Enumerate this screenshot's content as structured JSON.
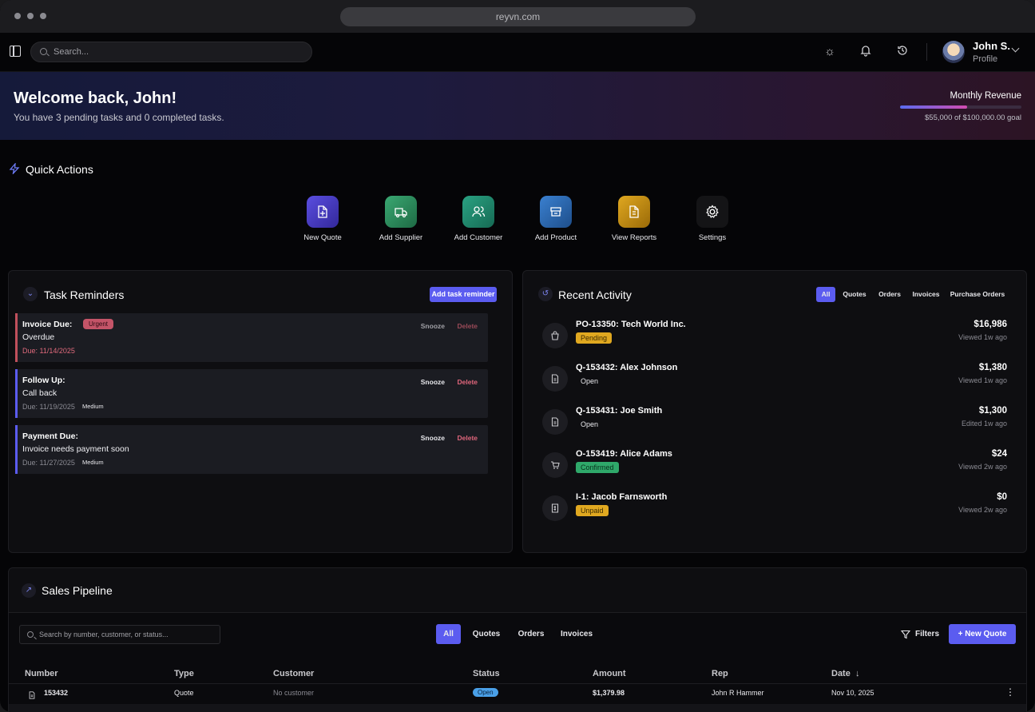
{
  "browser": {
    "url": "reyvn.com"
  },
  "topbar": {
    "search_placeholder": "Search...",
    "user_name": "John S.",
    "user_sub": "Profile"
  },
  "banner": {
    "welcome": "Welcome back, John!",
    "subtitle": "You have 3 pending tasks and 0 completed tasks.",
    "revenue_title": "Monthly Revenue",
    "revenue_text": "$55,000 of $100,000.00 goal",
    "revenue_progress": 0.55
  },
  "quick_actions": {
    "title": "Quick Actions",
    "items": [
      {
        "label": "New Quote",
        "icon": "file-plus-icon",
        "color": "#4a3ec8"
      },
      {
        "label": "Add Supplier",
        "icon": "truck-icon",
        "color": "#2a8a5a"
      },
      {
        "label": "Add Customer",
        "icon": "users-icon",
        "color": "#1e8a6a"
      },
      {
        "label": "Add Product",
        "icon": "box-icon",
        "color": "#2a6ab8"
      },
      {
        "label": "View Reports",
        "icon": "report-icon",
        "color": "#c08a10"
      },
      {
        "label": "Settings",
        "icon": "gear-icon",
        "color": "#141416"
      }
    ]
  },
  "tasks": {
    "title": "Task Reminders",
    "add_label": "Add task reminder",
    "snooze_label": "Snooze",
    "delete_label": "Delete",
    "items": [
      {
        "type": "Invoice Due:",
        "desc": "Overdue",
        "due": "Due: 11/14/2025",
        "badge": "Urgent"
      },
      {
        "type": "Follow Up:",
        "desc": "Call back",
        "due": "Due: 11/19/2025",
        "badge": "Medium"
      },
      {
        "type": "Payment Due:",
        "desc": "Invoice needs payment soon",
        "due": "Due: 11/27/2025",
        "badge": "Medium"
      }
    ]
  },
  "activity": {
    "title": "Recent Activity",
    "filters": [
      "All",
      "Quotes",
      "Orders",
      "Invoices",
      "Purchase Orders"
    ],
    "items": [
      {
        "title": "PO-13350: Tech World Inc.",
        "status": "Pending",
        "amount": "$16,986",
        "time": "Viewed 1w ago",
        "icon": "bag-icon"
      },
      {
        "title": "Q-153432: Alex Johnson",
        "status": "Open",
        "amount": "$1,380",
        "time": "Viewed 1w ago",
        "icon": "document-icon"
      },
      {
        "title": "Q-153431: Joe Smith",
        "status": "Open",
        "amount": "$1,300",
        "time": "Edited 1w ago",
        "icon": "document-icon"
      },
      {
        "title": "O-153419: Alice Adams",
        "status": "Confirmed",
        "amount": "$24",
        "time": "Viewed 2w ago",
        "icon": "cart-icon"
      },
      {
        "title": "I-1: Jacob Farnsworth",
        "status": "Unpaid",
        "amount": "$0",
        "time": "Viewed 2w ago",
        "icon": "invoice-icon"
      }
    ]
  },
  "pipeline": {
    "title": "Sales Pipeline",
    "search_placeholder": "Search by number, customer, or status...",
    "tabs": [
      "All",
      "Quotes",
      "Orders",
      "Invoices"
    ],
    "filters_label": "Filters",
    "new_quote_label": "New Quote",
    "columns": [
      "Number",
      "Type",
      "Customer",
      "Status",
      "Amount",
      "Rep",
      "Date"
    ],
    "rows": [
      {
        "number": "153432",
        "type": "Quote",
        "customer": "No customer",
        "status": "Open",
        "amount": "$1,379.98",
        "rep": "John R Hammer",
        "date": "Nov 10, 2025"
      }
    ]
  }
}
